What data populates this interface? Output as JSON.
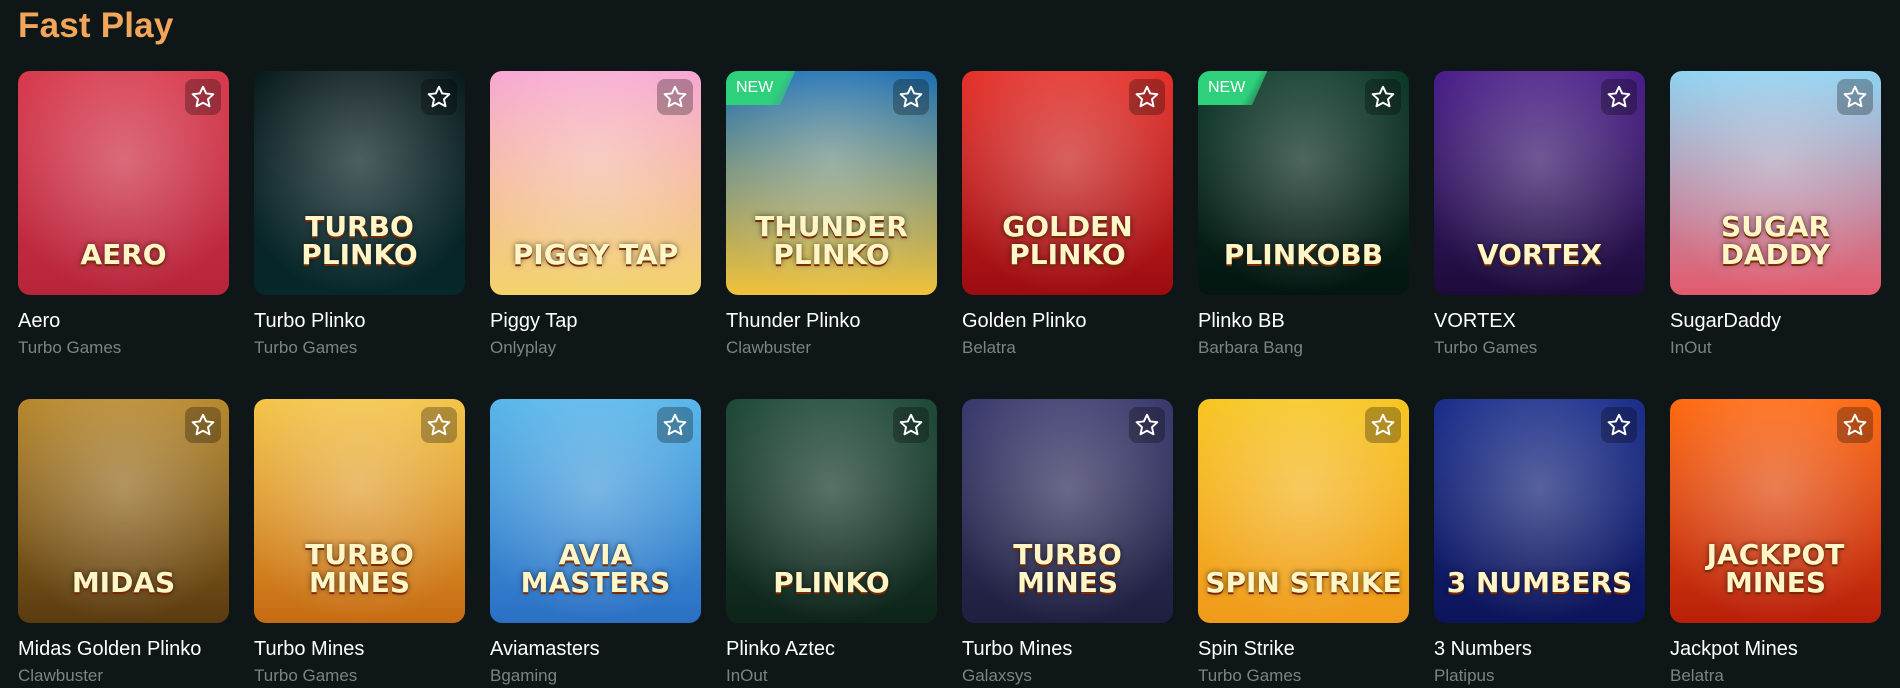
{
  "section": {
    "title": "Fast Play"
  },
  "games": [
    {
      "name": "Aero",
      "provider": "Turbo Games",
      "thumb_text": "AERO",
      "is_new": false,
      "bg": [
        "#d83a4e",
        "#b8243a"
      ]
    },
    {
      "name": "Turbo Plinko",
      "provider": "Turbo Games",
      "thumb_text": "TURBO PLINKO",
      "is_new": false,
      "bg": [
        "#0b1c1e",
        "#06282b"
      ]
    },
    {
      "name": "Piggy Tap",
      "provider": "Onlyplay",
      "thumb_text": "PIGGY TAP",
      "is_new": false,
      "bg": [
        "#f7a8d4",
        "#f3d36b"
      ]
    },
    {
      "name": "Thunder Plinko",
      "provider": "Clawbuster",
      "thumb_text": "THUNDER PLINKO",
      "is_new": true,
      "new_label": "NEW",
      "bg": [
        "#1b6fb3",
        "#f0c23c"
      ]
    },
    {
      "name": "Golden Plinko",
      "provider": "Belatra",
      "thumb_text": "GOLDEN PLINKO",
      "is_new": false,
      "bg": [
        "#e5322b",
        "#9c0c10"
      ]
    },
    {
      "name": "Plinko BB",
      "provider": "Barbara Bang",
      "thumb_text": "PlinkoBB",
      "is_new": true,
      "new_label": "NEW",
      "bg": [
        "#0d3a2a",
        "#031510"
      ]
    },
    {
      "name": "VORTEX",
      "provider": "Turbo Games",
      "thumb_text": "VORTEX",
      "is_new": false,
      "bg": [
        "#4b1f8a",
        "#1c0c3a"
      ]
    },
    {
      "name": "SugarDaddy",
      "provider": "InOut",
      "thumb_text": "SUGAR DADDY",
      "is_new": false,
      "bg": [
        "#8fd3f2",
        "#e35a6d"
      ]
    },
    {
      "name": "Midas Golden Plinko",
      "provider": "Clawbuster",
      "thumb_text": "MIDAS",
      "is_new": false,
      "bg": [
        "#b8892e",
        "#5a3b10"
      ]
    },
    {
      "name": "Turbo Mines",
      "provider": "Turbo Games",
      "thumb_text": "TURBO MINES",
      "is_new": false,
      "bg": [
        "#f4c54a",
        "#c66b12"
      ]
    },
    {
      "name": "Aviamasters",
      "provider": "Bgaming",
      "thumb_text": "AVIA MASTERS",
      "is_new": false,
      "bg": [
        "#58b7ea",
        "#2a6fc4"
      ]
    },
    {
      "name": "Plinko Aztec",
      "provider": "InOut",
      "thumb_text": "PLINKO",
      "is_new": false,
      "bg": [
        "#1f4a3a",
        "#0e2419"
      ]
    },
    {
      "name": "Turbo Mines",
      "provider": "Galaxsys",
      "thumb_text": "TURBO MINES",
      "is_new": false,
      "bg": [
        "#3b3a6e",
        "#1f1f40"
      ]
    },
    {
      "name": "Spin Strike",
      "provider": "Turbo Games",
      "thumb_text": "SPIN STRIKE",
      "is_new": false,
      "bg": [
        "#f7c623",
        "#f09a1b"
      ]
    },
    {
      "name": "3 Numbers",
      "provider": "Platipus",
      "thumb_text": "3 Numbers",
      "is_new": false,
      "bg": [
        "#1b2f8c",
        "#0c145a"
      ]
    },
    {
      "name": "Jackpot Mines",
      "provider": "Belatra",
      "thumb_text": "JACKPOT MINES",
      "is_new": false,
      "bg": [
        "#ff6a12",
        "#b81f0a"
      ]
    }
  ]
}
